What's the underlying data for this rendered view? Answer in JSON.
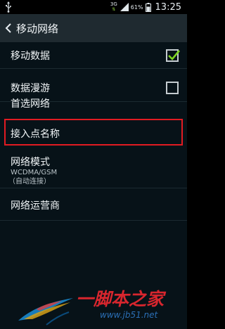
{
  "status_bar": {
    "network_type": "3G",
    "battery_percent": "61%",
    "time": "13:25",
    "icons": [
      "usb-icon",
      "data-arrows-icon",
      "signal-icon",
      "battery-icon"
    ]
  },
  "action_bar": {
    "title": "移动网络",
    "back_icon": "chevron-left-icon"
  },
  "settings": {
    "items": [
      {
        "label": "移动数据",
        "checked": true
      },
      {
        "label": "数据漫游",
        "checked": false
      },
      {
        "label": "首选网络"
      },
      {
        "label": "接入点名称",
        "highlighted": true
      },
      {
        "label": "网络模式",
        "sub1": "WCDMA/GSM",
        "sub2": "（自动连接）"
      },
      {
        "label": "网络运营商"
      }
    ]
  },
  "colors": {
    "action_bar_bg": "#1f2a30",
    "content_bg": "#071218",
    "check_green": "#7ed321",
    "highlight_red": "#e21b22"
  },
  "watermark": {
    "text": "一脚本之家",
    "url": "www.jb51.net"
  }
}
